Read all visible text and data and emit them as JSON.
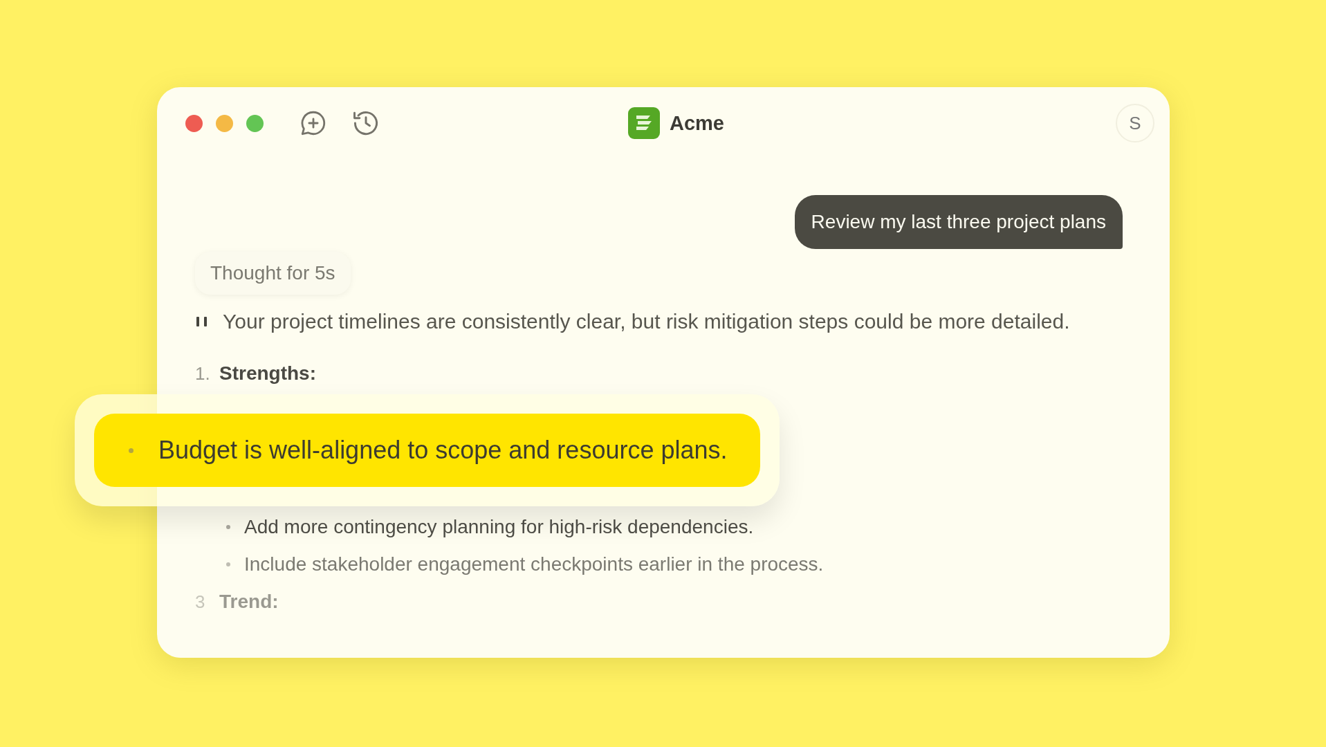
{
  "window": {
    "title": "Acme",
    "avatar": "S"
  },
  "user_message": "Review my last three project plans",
  "thought": "Thought for 5s",
  "quote": "Your project timelines are consistently  clear, but risk mitigation steps could be more detailed.",
  "outline": [
    {
      "kind": "heading",
      "number": "1.",
      "text": "Strengths:"
    },
    {
      "kind": "bullet",
      "text": "Add more contingency planning for high-risk dependencies."
    },
    {
      "kind": "bullet",
      "text": "Include stakeholder engagement checkpoints earlier in the process."
    },
    {
      "kind": "heading",
      "number": "3",
      "text": "Trend:"
    }
  ],
  "highlight": {
    "text": "Budget is well-aligned to scope and resource plans."
  }
}
